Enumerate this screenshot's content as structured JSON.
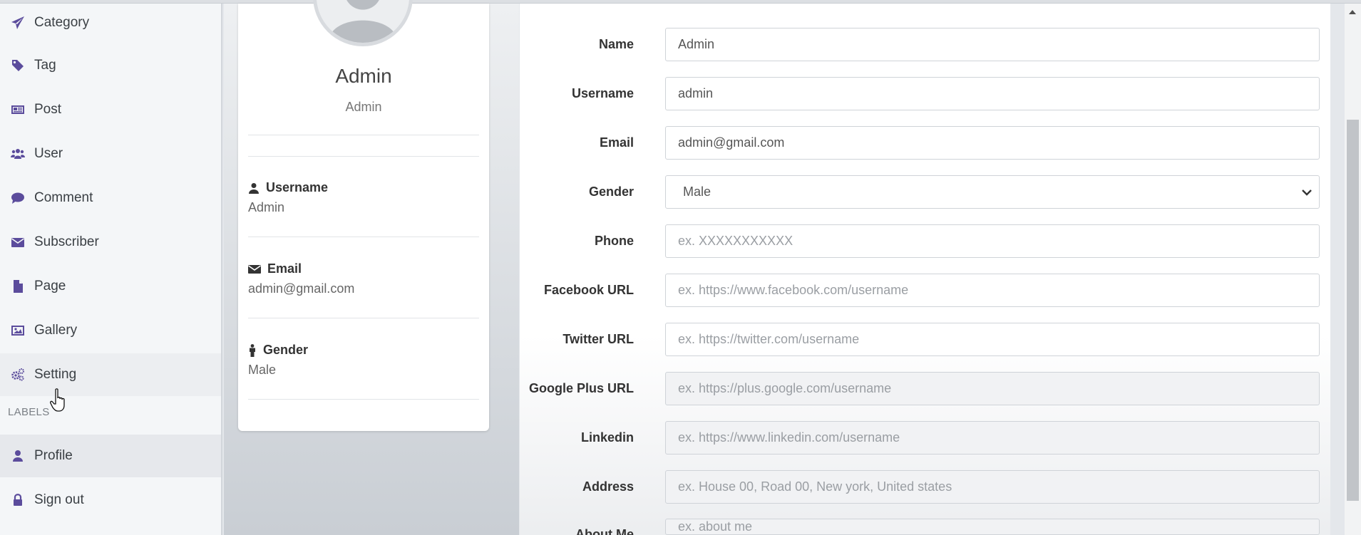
{
  "sidebar": {
    "items": [
      {
        "label": "Category",
        "icon": "paper-plane-icon"
      },
      {
        "label": "Tag",
        "icon": "tag-icon"
      },
      {
        "label": "Post",
        "icon": "newspaper-icon"
      },
      {
        "label": "User",
        "icon": "users-icon"
      },
      {
        "label": "Comment",
        "icon": "comment-icon"
      },
      {
        "label": "Subscriber",
        "icon": "envelope-icon"
      },
      {
        "label": "Page",
        "icon": "file-icon"
      },
      {
        "label": "Gallery",
        "icon": "image-icon"
      },
      {
        "label": "Setting",
        "icon": "gears-icon"
      }
    ],
    "labels_header": "LABELS",
    "label_items": [
      {
        "label": "Profile",
        "icon": "user-icon"
      },
      {
        "label": "Sign out",
        "icon": "lock-icon"
      }
    ]
  },
  "profile_card": {
    "name": "Admin",
    "role": "Admin",
    "fields": [
      {
        "label": "Username",
        "value": "Admin",
        "icon": "user-icon"
      },
      {
        "label": "Email",
        "value": "admin@gmail.com",
        "icon": "envelope-icon"
      },
      {
        "label": "Gender",
        "value": "Male",
        "icon": "male-icon"
      }
    ]
  },
  "form": {
    "name": {
      "label": "Name",
      "value": "Admin"
    },
    "username": {
      "label": "Username",
      "value": "admin"
    },
    "email": {
      "label": "Email",
      "value": "admin@gmail.com"
    },
    "gender": {
      "label": "Gender",
      "value": "Male"
    },
    "phone": {
      "label": "Phone",
      "placeholder": "ex. XXXXXXXXXXX"
    },
    "facebook": {
      "label": "Facebook URL",
      "placeholder": "ex. https://www.facebook.com/username"
    },
    "twitter": {
      "label": "Twitter URL",
      "placeholder": "ex. https://twitter.com/username"
    },
    "googleplus": {
      "label": "Google Plus URL",
      "placeholder": "ex. https://plus.google.com/username"
    },
    "linkedin": {
      "label": "Linkedin",
      "placeholder": "ex. https://www.linkedin.com/username"
    },
    "address": {
      "label": "Address",
      "placeholder": "ex. House 00, Road 00, New york, United states"
    },
    "about": {
      "label": "About Me",
      "placeholder": "ex. about me"
    }
  },
  "colors": {
    "icon_accent": "#5b4c9c",
    "sidebar_bg": "#f4f6f8",
    "panel_bg": "#ffffff"
  }
}
